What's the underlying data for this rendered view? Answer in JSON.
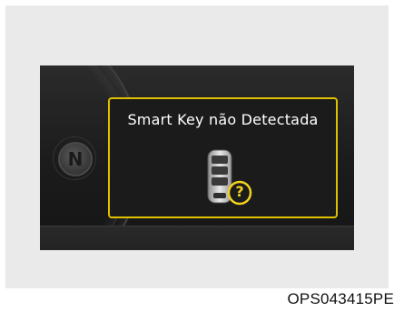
{
  "display": {
    "message": "Smart Key não Detectada",
    "gear_indicator": "N",
    "status_symbol": "?"
  },
  "caption": {
    "figure_code": "OPS043415PE"
  },
  "colors": {
    "popup_border": "#e0c000",
    "question_badge": "#f2d21b",
    "screen_background": "#1c1c1c"
  },
  "icons": {
    "smart_key": "smart-key-fob-icon",
    "question": "question-mark-icon"
  }
}
